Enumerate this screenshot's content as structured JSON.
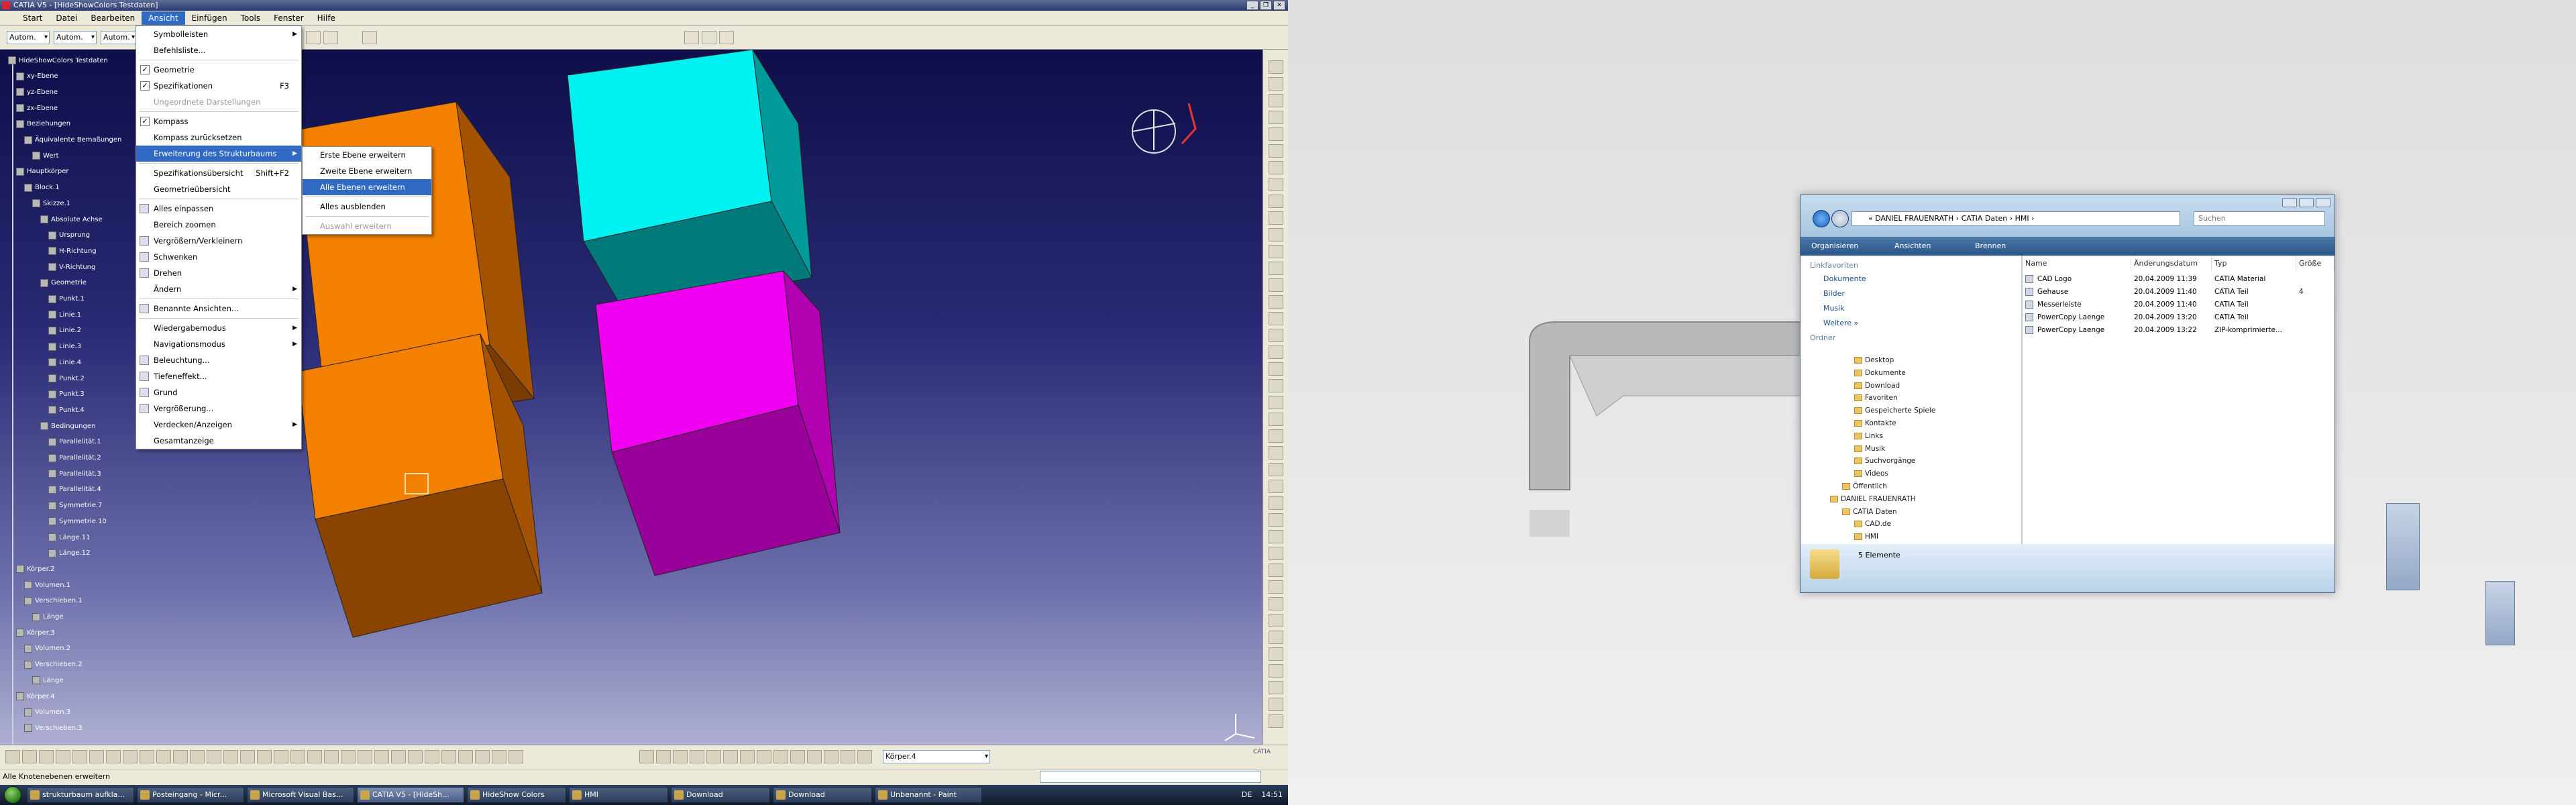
{
  "catia": {
    "title": "CATIA V5 - [HideShowColors Testdaten]",
    "menus": [
      "Start",
      "Datei",
      "Bearbeiten",
      "Ansicht",
      "Einfügen",
      "Tools",
      "Fenster",
      "Hilfe"
    ],
    "combos": [
      "Autom.",
      "Autom.",
      "Autom."
    ],
    "status_text": "Alle Knotenebenen erweitern",
    "bottom_combo": "Körper.4",
    "logo_text": "CATIA"
  },
  "tree": [
    {
      "label": "HideShowColors Testdaten",
      "level": 0
    },
    {
      "label": "xy-Ebene",
      "level": 1
    },
    {
      "label": "yz-Ebene",
      "level": 1
    },
    {
      "label": "zx-Ebene",
      "level": 1
    },
    {
      "label": "Beziehungen",
      "level": 1
    },
    {
      "label": "Äquivalente Bemaßungen",
      "level": 2
    },
    {
      "label": "Wert",
      "level": 3
    },
    {
      "label": "Hauptkörper",
      "level": 1
    },
    {
      "label": "Block.1",
      "level": 2
    },
    {
      "label": "Skizze.1",
      "level": 3
    },
    {
      "label": "Absolute Achse",
      "level": 4
    },
    {
      "label": "Ursprung",
      "level": 5
    },
    {
      "label": "H-Richtung",
      "level": 5
    },
    {
      "label": "V-Richtung",
      "level": 5
    },
    {
      "label": "Geometrie",
      "level": 4
    },
    {
      "label": "Punkt.1",
      "level": 5
    },
    {
      "label": "Linie.1",
      "level": 5
    },
    {
      "label": "Linie.2",
      "level": 5
    },
    {
      "label": "Linie.3",
      "level": 5
    },
    {
      "label": "Linie.4",
      "level": 5
    },
    {
      "label": "Punkt.2",
      "level": 5
    },
    {
      "label": "Punkt.3",
      "level": 5
    },
    {
      "label": "Punkt.4",
      "level": 5
    },
    {
      "label": "Bedingungen",
      "level": 4
    },
    {
      "label": "Parallelität.1",
      "level": 5
    },
    {
      "label": "Parallelität.2",
      "level": 5
    },
    {
      "label": "Parallelität.3",
      "level": 5
    },
    {
      "label": "Parallelität.4",
      "level": 5
    },
    {
      "label": "Symmetrie.7",
      "level": 5
    },
    {
      "label": "Symmetrie.10",
      "level": 5
    },
    {
      "label": "Länge.11",
      "level": 5
    },
    {
      "label": "Länge.12",
      "level": 5
    },
    {
      "label": "Körper.2",
      "level": 1
    },
    {
      "label": "Volumen.1",
      "level": 2
    },
    {
      "label": "Verschieben.1",
      "level": 2
    },
    {
      "label": "Länge",
      "level": 3
    },
    {
      "label": "Körper.3",
      "level": 1
    },
    {
      "label": "Volumen.2",
      "level": 2
    },
    {
      "label": "Verschieben.2",
      "level": 2
    },
    {
      "label": "Länge",
      "level": 3
    },
    {
      "label": "Körper.4",
      "level": 1
    },
    {
      "label": "Volumen.3",
      "level": 2
    },
    {
      "label": "Verschieben.3",
      "level": 2
    }
  ],
  "ansicht_menu": [
    {
      "label": "Symbolleisten",
      "type": "submenu"
    },
    {
      "label": "Befehlsliste...",
      "type": "item"
    },
    {
      "type": "sep"
    },
    {
      "label": "Geometrie",
      "type": "check"
    },
    {
      "label": "Spezifikationen",
      "type": "check",
      "shortcut": "F3"
    },
    {
      "label": "Ungeordnete Darstellungen",
      "type": "disabled"
    },
    {
      "type": "sep"
    },
    {
      "label": "Kompass",
      "type": "check"
    },
    {
      "label": "Kompass zurücksetzen",
      "type": "item"
    },
    {
      "label": "Erweiterung des Strukturbaums",
      "type": "submenu",
      "highlight": true
    },
    {
      "type": "sep"
    },
    {
      "label": "Spezifikationsübersicht",
      "type": "item",
      "shortcut": "Shift+F2"
    },
    {
      "label": "Geometrieübersicht",
      "type": "item"
    },
    {
      "type": "sep"
    },
    {
      "label": "Alles einpassen",
      "type": "icon"
    },
    {
      "label": "Bereich zoomen",
      "type": "item"
    },
    {
      "label": "Vergrößern/Verkleinern",
      "type": "icon"
    },
    {
      "label": "Schwenken",
      "type": "icon"
    },
    {
      "label": "Drehen",
      "type": "icon"
    },
    {
      "label": "Ändern",
      "type": "submenu"
    },
    {
      "type": "sep"
    },
    {
      "label": "Benannte Ansichten...",
      "type": "icon"
    },
    {
      "type": "sep"
    },
    {
      "label": "Wiedergabemodus",
      "type": "submenu"
    },
    {
      "label": "Navigationsmodus",
      "type": "submenu"
    },
    {
      "label": "Beleuchtung...",
      "type": "icon"
    },
    {
      "label": "Tiefeneffekt...",
      "type": "icon"
    },
    {
      "label": "Grund",
      "type": "icon"
    },
    {
      "label": "Vergrößerung...",
      "type": "icon"
    },
    {
      "label": "Verdecken/Anzeigen",
      "type": "submenu"
    },
    {
      "label": "Gesamtanzeige",
      "type": "item"
    }
  ],
  "sub_menu": [
    {
      "label": "Erste Ebene erweitern",
      "type": "item"
    },
    {
      "label": "Zweite Ebene erweitern",
      "type": "item"
    },
    {
      "label": "Alle Ebenen erweitern",
      "type": "item",
      "highlight": true
    },
    {
      "type": "sep"
    },
    {
      "label": "Alles ausblenden",
      "type": "item"
    },
    {
      "type": "sep"
    },
    {
      "label": "Auswahl erweitern",
      "type": "disabled"
    }
  ],
  "taskbar": {
    "tasks": [
      "strukturbaum aufkla...",
      "Posteingang - Micr...",
      "Microsoft Visual Bas...",
      "CATIA V5 - [HideSh...",
      "HideShow Colors",
      "HMI",
      "Download",
      "Download",
      "Unbenannt - Paint"
    ],
    "active_index": 3,
    "clock": "14:51",
    "lang": "DE"
  },
  "explorer": {
    "address": "« DANIEL FRAUENRATH › CATIA Daten › HMI ›",
    "search_placeholder": "Suchen",
    "toolbar": [
      "Organisieren",
      "Ansichten",
      "Brennen"
    ],
    "linkfavoriten_header": "Linkfavoriten",
    "favorites": [
      "Dokumente",
      "Bilder",
      "Musik",
      "Weitere »"
    ],
    "ordner_header": "Ordner",
    "folders": [
      {
        "label": "Desktop",
        "indent": 2
      },
      {
        "label": "Dokumente",
        "indent": 2
      },
      {
        "label": "Download",
        "indent": 2
      },
      {
        "label": "Favoriten",
        "indent": 2
      },
      {
        "label": "Gespeicherte Spiele",
        "indent": 2
      },
      {
        "label": "Kontakte",
        "indent": 2
      },
      {
        "label": "Links",
        "indent": 2
      },
      {
        "label": "Musik",
        "indent": 2
      },
      {
        "label": "Suchvorgänge",
        "indent": 2
      },
      {
        "label": "Videos",
        "indent": 2
      },
      {
        "label": "Öffentlich",
        "indent": 1
      },
      {
        "label": "DANIEL FRAUENRATH",
        "indent": 0
      },
      {
        "label": "CATIA Daten",
        "indent": 1
      },
      {
        "label": "CAD.de",
        "indent": 2
      },
      {
        "label": "HMI",
        "indent": 2
      }
    ],
    "columns": [
      "Name",
      "Änderungsdatum",
      "Typ",
      "Größe"
    ],
    "files": [
      {
        "name": "CAD Logo",
        "date": "20.04.2009 11:39",
        "type": "CATIA Material",
        "size": ""
      },
      {
        "name": "Gehause",
        "date": "20.04.2009 11:40",
        "type": "CATIA Teil",
        "size": "4"
      },
      {
        "name": "Messerleiste",
        "date": "20.04.2009 11:40",
        "type": "CATIA Teil",
        "size": ""
      },
      {
        "name": "PowerCopy Laenge",
        "date": "20.04.2009 13:20",
        "type": "CATIA Teil",
        "size": ""
      },
      {
        "name": "PowerCopy Laenge",
        "date": "20.04.2009 13:22",
        "type": "ZIP-komprimierte...",
        "size": ""
      }
    ],
    "status_count": "5 Elemente"
  },
  "colors": {
    "orange": "#f38000",
    "cyan": "#00f1f1",
    "teal": "#009a9a",
    "magenta": "#f000f0",
    "purple": "#9a009a",
    "menu_highlight": "#316ac5"
  }
}
